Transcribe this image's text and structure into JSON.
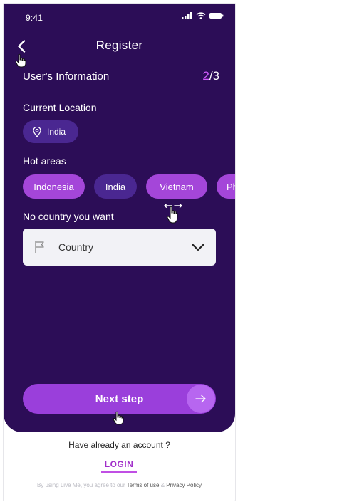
{
  "status_bar": {
    "time": "9:41"
  },
  "nav": {
    "title": "Register"
  },
  "section": {
    "title": "User's Information",
    "step_current": "2",
    "step_total": "/3"
  },
  "current_location": {
    "label": "Current Location",
    "value": "India"
  },
  "hot_areas": {
    "label": "Hot areas",
    "items": [
      {
        "label": "Indonesia",
        "selected": true
      },
      {
        "label": "India",
        "selected": false
      },
      {
        "label": "Vietnam",
        "selected": true
      },
      {
        "label": "Philippines",
        "selected": true
      }
    ]
  },
  "country_picker": {
    "label": "No country you want",
    "placeholder": "Country"
  },
  "next_button": {
    "label": "Next step"
  },
  "footer": {
    "question": "Have already an account ?",
    "login_label": "LOGIN",
    "legal_prefix": "By using Live Me, you agree to our ",
    "terms_label": "Terms of use",
    "legal_and": " & ",
    "privacy_label": "Privacy Policy"
  },
  "colors": {
    "panel_bg": "#2c0d57",
    "accent": "#d35cff",
    "chip_selected": "#a446d9",
    "chip_unselected": "#4a2791",
    "button": "#9a3fdb",
    "login_link": "#a12ec9"
  },
  "icons": [
    "signal-icon",
    "wifi-icon",
    "battery-icon",
    "back-chevron-icon",
    "location-pin-icon",
    "flag-icon",
    "chevron-down-icon",
    "arrow-right-icon",
    "hand-pointer-icon",
    "drag-hand-icon"
  ]
}
